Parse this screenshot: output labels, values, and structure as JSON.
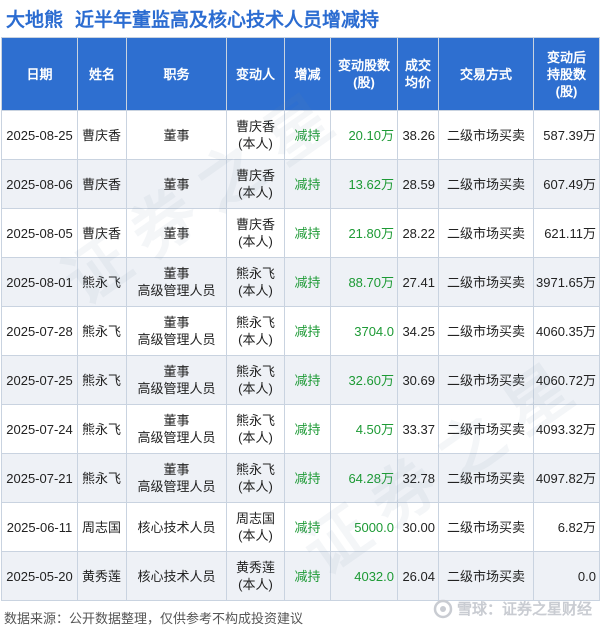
{
  "title": {
    "stock": "大地熊",
    "text": "近半年董监高及核心技术人员增减持"
  },
  "headers": {
    "date": "日期",
    "name": "姓名",
    "position": "职务",
    "changer": "变动人",
    "direction": "增减",
    "change_shares": [
      "变动股数",
      "(股)"
    ],
    "avg_price": [
      "成交",
      "均价"
    ],
    "method": "交易方式",
    "holdings_after": [
      "变动后",
      "持股数",
      "(股)"
    ]
  },
  "rows": [
    {
      "date": "2025-08-25",
      "name": "曹庆香",
      "position": [
        "董事"
      ],
      "changer": [
        "曹庆香",
        "(本人)"
      ],
      "direction": "减持",
      "shares": "20.10万",
      "price": "38.26",
      "method": "二级市场买卖",
      "after": "587.39万"
    },
    {
      "date": "2025-08-06",
      "name": "曹庆香",
      "position": [
        "董事"
      ],
      "changer": [
        "曹庆香",
        "(本人)"
      ],
      "direction": "减持",
      "shares": "13.62万",
      "price": "28.59",
      "method": "二级市场买卖",
      "after": "607.49万"
    },
    {
      "date": "2025-08-05",
      "name": "曹庆香",
      "position": [
        "董事"
      ],
      "changer": [
        "曹庆香",
        "(本人)"
      ],
      "direction": "减持",
      "shares": "21.80万",
      "price": "28.22",
      "method": "二级市场买卖",
      "after": "621.11万"
    },
    {
      "date": "2025-08-01",
      "name": "熊永飞",
      "position": [
        "董事",
        "高级管理人员"
      ],
      "changer": [
        "熊永飞",
        "(本人)"
      ],
      "direction": "减持",
      "shares": "88.70万",
      "price": "27.41",
      "method": "二级市场买卖",
      "after": "3971.65万"
    },
    {
      "date": "2025-07-28",
      "name": "熊永飞",
      "position": [
        "董事",
        "高级管理人员"
      ],
      "changer": [
        "熊永飞",
        "(本人)"
      ],
      "direction": "减持",
      "shares": "3704.0",
      "price": "34.25",
      "method": "二级市场买卖",
      "after": "4060.35万"
    },
    {
      "date": "2025-07-25",
      "name": "熊永飞",
      "position": [
        "董事",
        "高级管理人员"
      ],
      "changer": [
        "熊永飞",
        "(本人)"
      ],
      "direction": "减持",
      "shares": "32.60万",
      "price": "30.69",
      "method": "二级市场买卖",
      "after": "4060.72万"
    },
    {
      "date": "2025-07-24",
      "name": "熊永飞",
      "position": [
        "董事",
        "高级管理人员"
      ],
      "changer": [
        "熊永飞",
        "(本人)"
      ],
      "direction": "减持",
      "shares": "4.50万",
      "price": "33.37",
      "method": "二级市场买卖",
      "after": "4093.32万"
    },
    {
      "date": "2025-07-21",
      "name": "熊永飞",
      "position": [
        "董事",
        "高级管理人员"
      ],
      "changer": [
        "熊永飞",
        "(本人)"
      ],
      "direction": "减持",
      "shares": "64.28万",
      "price": "32.78",
      "method": "二级市场买卖",
      "after": "4097.82万"
    },
    {
      "date": "2025-06-11",
      "name": "周志国",
      "position": [
        "核心技术人员"
      ],
      "changer": [
        "周志国",
        "(本人)"
      ],
      "direction": "减持",
      "shares": "5000.0",
      "price": "30.00",
      "method": "二级市场买卖",
      "after": "6.82万"
    },
    {
      "date": "2025-05-20",
      "name": "黄秀莲",
      "position": [
        "核心技术人员"
      ],
      "changer": [
        "黄秀莲",
        "(本人)"
      ],
      "direction": "减持",
      "shares": "4032.0",
      "price": "26.04",
      "method": "二级市场买卖",
      "after": "0.0"
    }
  ],
  "footer": {
    "source": "数据来源：公开数据整理，仅供参考不构成投资建议",
    "brand": "雪球：证券之星财经"
  },
  "colors": {
    "header_bg": "#2e6fd0",
    "title": "#2b6cd1",
    "decrease": "#1d9a35",
    "stripe": "#eef1f6"
  },
  "icons": {
    "brand_logo": "snowball-logo-icon"
  }
}
